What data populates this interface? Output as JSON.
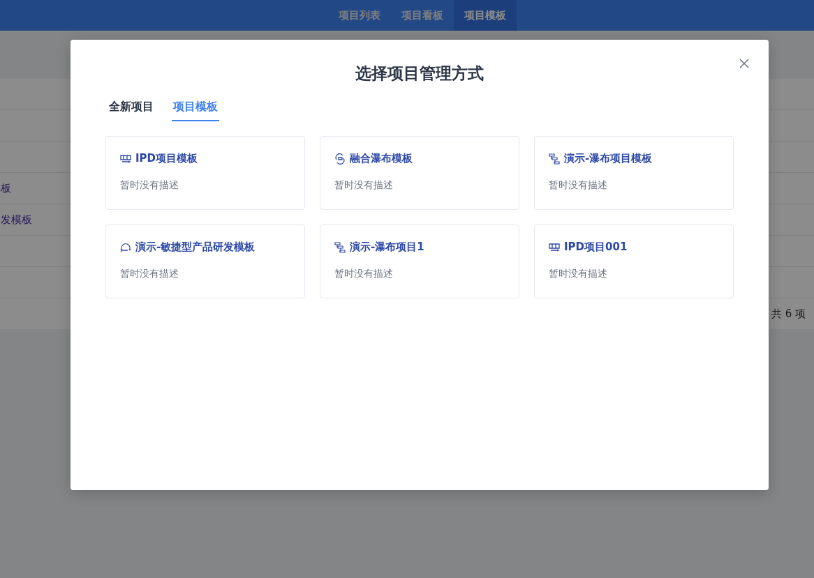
{
  "nav": {
    "tabs": [
      {
        "label": "项目列表",
        "selected": false
      },
      {
        "label": "项目看板",
        "selected": false
      },
      {
        "label": "项目模板",
        "selected": true
      }
    ]
  },
  "table": {
    "rows": [
      {
        "name": "板"
      },
      {
        "name": "发模板"
      }
    ],
    "pagination": "共 6 项"
  },
  "dialog": {
    "title": "选择项目管理方式",
    "tabs": [
      {
        "label": "全新项目",
        "selected": false
      },
      {
        "label": "项目模板",
        "selected": true
      }
    ],
    "templates": [
      {
        "kind": "board",
        "name": "IPD项目模板",
        "description": "暂时没有描述"
      },
      {
        "kind": "merge",
        "name": "融合瀑布模板",
        "description": "暂时没有描述"
      },
      {
        "kind": "waterfall",
        "name": "演示-瀑布项目模板",
        "description": "暂时没有描述"
      },
      {
        "kind": "agile",
        "name": "演示-敏捷型产品研发模板",
        "description": "暂时没有描述"
      },
      {
        "kind": "waterfall",
        "name": "演示-瀑布项目1",
        "description": "暂时没有描述"
      },
      {
        "kind": "board",
        "name": "IPD项目001",
        "description": "暂时没有描述"
      }
    ]
  }
}
